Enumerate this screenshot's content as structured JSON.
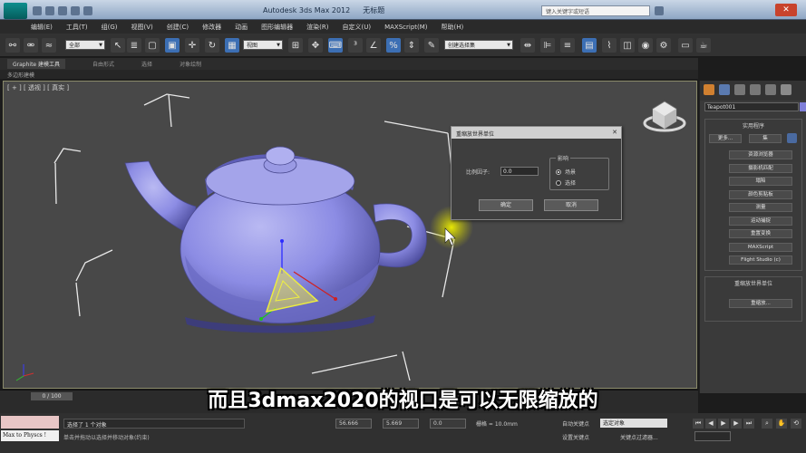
{
  "window": {
    "title": "Autodesk 3ds Max  2012",
    "file": "无标题",
    "help_search_placeholder": "键入关键字或短语"
  },
  "menu": [
    "编辑(E)",
    "工具(T)",
    "组(G)",
    "视图(V)",
    "创建(C)",
    "修改器",
    "动画",
    "图形编辑器",
    "渲染(R)",
    "自定义(U)",
    "MAXScript(M)",
    "帮助(H)"
  ],
  "toolbar": {
    "selection_filter": "全部",
    "reference_coord": "视图",
    "named_selection": "创建选择集"
  },
  "ribbon": {
    "tabs": [
      "Graphite 建模工具",
      "自由形式",
      "选择",
      "对象绘制"
    ],
    "sub": "多边形建模"
  },
  "viewport": {
    "label": "[ + ] [ 透视 ] [ 真实 ]"
  },
  "dialog": {
    "title": "重缩放世界单位",
    "close": "✕",
    "scale_label": "比例因子:",
    "scale_value": "0.0",
    "affect_title": "影响",
    "options": [
      "场景",
      "选择"
    ],
    "selected_option": "场景",
    "ok": "确定",
    "cancel": "取消"
  },
  "command_panel": {
    "object_name": "Teapot001",
    "object_color": "#7f7fd8",
    "utilities_title": "实用程序",
    "more_button": "更多...",
    "sets_button": "集",
    "utilities": [
      "资源浏览器",
      "摄影机匹配",
      "塌陷",
      "颜色剪贴板",
      "测量",
      "运动捕捉",
      "重置变换",
      "MAXScript",
      "Flight Studio (c)"
    ],
    "rescale_rollout_title": "重缩放世界单位",
    "rescale_button": "重缩放..."
  },
  "timeline": {
    "frame": "0 / 100"
  },
  "status": {
    "listener_text": "Max to Physcs !",
    "selected": "选择了 1 个对象",
    "prompt": "单击并拖动以选择并移动对象(约束)",
    "x": "56.666",
    "y": "5.669",
    "z": "0.0",
    "grid": "栅格 = 10.0mm",
    "autokey": "自动关键点",
    "autokey_mode": "选定对象",
    "setkey": "设置关键点",
    "key_filters": "关键点过滤器..."
  },
  "subtitle": "而且3dmax2020的视口是可以无限缩放的"
}
